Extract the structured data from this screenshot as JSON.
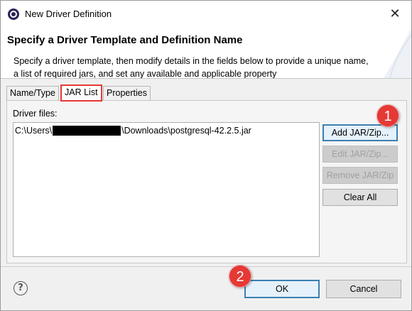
{
  "window": {
    "title": "New Driver Definition",
    "close_glyph": "✕"
  },
  "header": {
    "title": "Specify a Driver Template and Definition Name",
    "description": "Specify a driver template, then modify details in the fields below to provide a unique name, a list of required jars, and set any available and applicable property"
  },
  "tabs": [
    {
      "label": "Name/Type",
      "selected": false
    },
    {
      "label": "JAR List",
      "selected": true
    },
    {
      "label": "Properties",
      "selected": false
    }
  ],
  "jar_list": {
    "label": "Driver files:",
    "items": [
      {
        "prefix": "C:\\Users\\",
        "suffix": "\\Downloads\\postgresql-42.2.5.jar"
      }
    ]
  },
  "side_buttons": {
    "add": "Add JAR/Zip...",
    "edit": "Edit JAR/Zip...",
    "remove": "Remove JAR/Zip",
    "clear": "Clear All"
  },
  "footer": {
    "help_glyph": "?",
    "ok": "OK",
    "cancel": "Cancel"
  },
  "markers": [
    "1",
    "2"
  ],
  "colors": {
    "marker": "#e53935",
    "selected_tab_outline": "#e53935",
    "primary_button_border": "#3c7fb1"
  }
}
